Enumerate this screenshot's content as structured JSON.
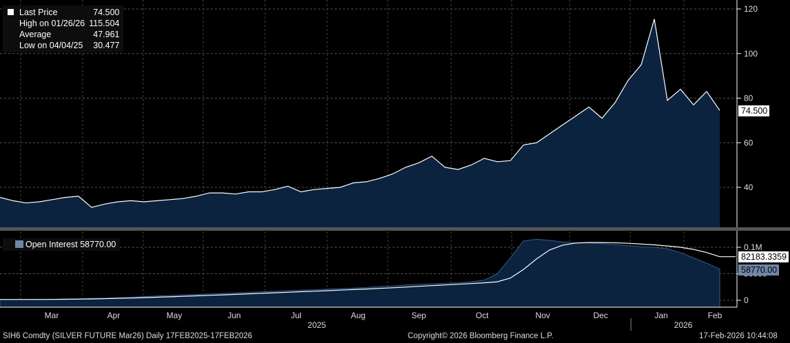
{
  "legend": {
    "last_label": "Last Price",
    "last": "74.500",
    "high_label": "High on 01/26/26",
    "high": "115.504",
    "avg_label": "Average",
    "avg": "47.961",
    "low_label": "Low on 04/04/25",
    "low": "30.477"
  },
  "oi_legend": {
    "label": "Open Interest",
    "value": "58770.00"
  },
  "tags": {
    "price": "74.500",
    "oi_ma": "82183.3359",
    "oi": "58770.00"
  },
  "footer": {
    "left": "SIH6 Comdty (SILVER FUTURE    Mar26) Daily 17FEB2025-17FEB2026",
    "center": "Copyright© 2026 Bloomberg Finance L.P.",
    "right": "17-Feb-2026 10:44:08"
  },
  "colors": {
    "area": "#0c2340",
    "line": "#ffffff",
    "oi_box": "#6f86a8"
  },
  "chart_data": [
    {
      "type": "area",
      "title": "Last Price",
      "yticks": [
        "40",
        "60",
        "80",
        "100",
        "120"
      ],
      "ylim": [
        20,
        122
      ],
      "xticks": [
        "Mar",
        "Apr",
        "May",
        "Jun",
        "Jul",
        "Aug",
        "Sep",
        "Oct",
        "Nov",
        "Dec",
        "Jan",
        "Feb"
      ],
      "years": [
        "2025",
        "2026"
      ],
      "values": [
        35.5,
        34,
        33,
        33.5,
        34.5,
        35.5,
        36,
        31,
        32.5,
        33.5,
        34,
        33.5,
        34,
        34.5,
        35,
        36,
        37.5,
        37.5,
        37,
        38,
        38,
        39,
        40.5,
        38,
        39,
        39.5,
        40,
        42,
        42.5,
        44,
        46,
        49,
        51,
        54,
        49,
        48,
        50,
        53,
        51.5,
        52,
        59,
        60,
        64,
        68,
        72,
        76,
        71,
        78,
        88,
        95,
        115.5,
        79,
        84,
        77,
        83,
        74.5
      ]
    },
    {
      "type": "area",
      "title": "Open Interest",
      "yticks": [
        "0",
        "50000",
        "0.1M"
      ],
      "ylim": [
        -10000,
        120000
      ],
      "values": [
        1500,
        1500,
        1600,
        1800,
        2000,
        2500,
        3000,
        3500,
        4000,
        5000,
        6000,
        7000,
        8000,
        9000,
        10000,
        11000,
        12000,
        13000,
        14000,
        15000,
        16000,
        17000,
        18000,
        19000,
        20000,
        21000,
        22000,
        23000,
        24000,
        26000,
        27000,
        29000,
        30000,
        31000,
        32000,
        33000,
        35000,
        38000,
        50000,
        80000,
        112000,
        115000,
        113000,
        110000,
        108000,
        108000,
        107000,
        105000,
        103000,
        101000,
        100000,
        97000,
        90000,
        80000,
        70000,
        58770
      ],
      "ma": [
        1500,
        1500,
        1500,
        1600,
        1700,
        1900,
        2200,
        2600,
        3000,
        3600,
        4200,
        5000,
        5800,
        6600,
        7500,
        8400,
        9300,
        10200,
        11200,
        12200,
        13200,
        14200,
        15200,
        16200,
        17200,
        18200,
        19200,
        20200,
        21300,
        22500,
        23700,
        25000,
        26300,
        27600,
        28900,
        30200,
        31500,
        33000,
        35000,
        42000,
        58000,
        78000,
        95000,
        104000,
        108000,
        109000,
        109000,
        108500,
        107500,
        106000,
        104500,
        102500,
        100000,
        96000,
        90000,
        82183
      ]
    }
  ]
}
